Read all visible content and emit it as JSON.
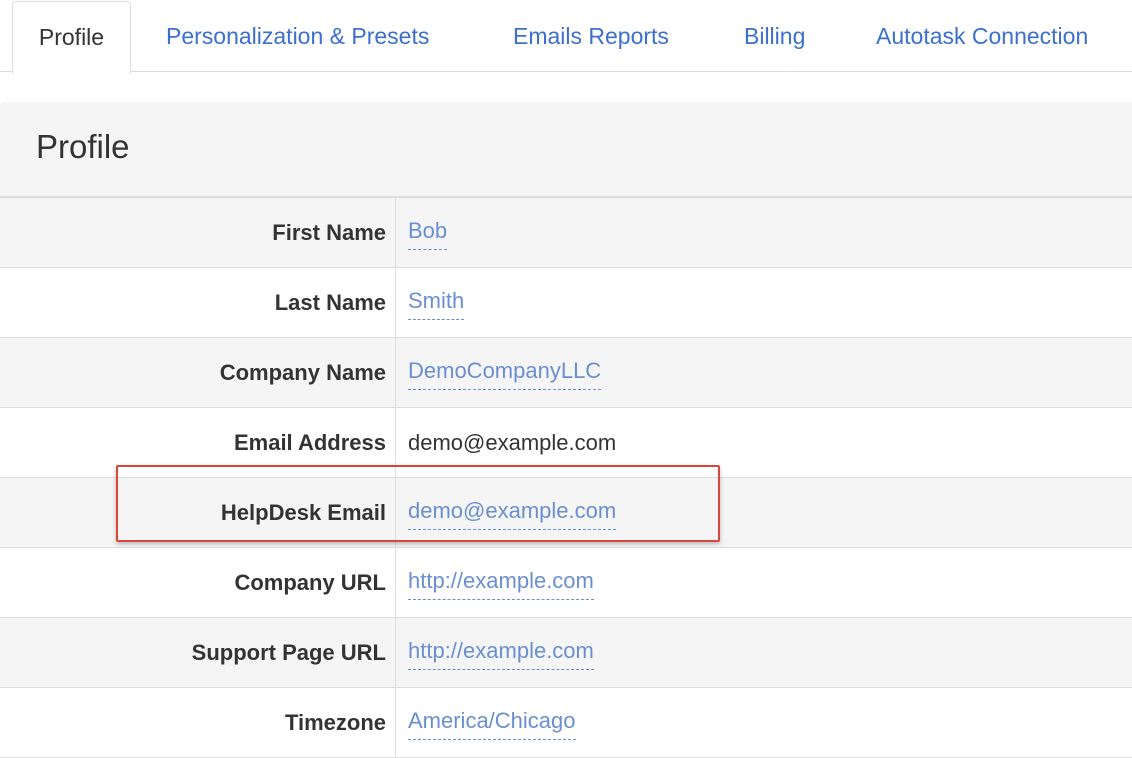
{
  "tabs": [
    {
      "label": "Profile",
      "active": true
    },
    {
      "label": "Personalization & Presets",
      "active": false
    },
    {
      "label": "Emails Reports",
      "active": false
    },
    {
      "label": "Billing",
      "active": false
    },
    {
      "label": "Autotask Connection",
      "active": false
    }
  ],
  "panel": {
    "title": "Profile"
  },
  "fields": [
    {
      "label": "First Name",
      "value": "Bob",
      "editable": true
    },
    {
      "label": "Last Name",
      "value": "Smith",
      "editable": true
    },
    {
      "label": "Company Name",
      "value": "DemoCompanyLLC",
      "editable": true
    },
    {
      "label": "Email Address",
      "value": "demo@example.com",
      "editable": false
    },
    {
      "label": "HelpDesk Email",
      "value": "demo@example.com",
      "editable": true,
      "highlighted": true
    },
    {
      "label": "Company URL",
      "value": "http://example.com",
      "editable": true
    },
    {
      "label": "Support Page URL",
      "value": "http://example.com",
      "editable": true
    },
    {
      "label": "Timezone",
      "value": "America/Chicago",
      "editable": true
    }
  ],
  "colors": {
    "link": "#3b6fd0",
    "editable_value": "#6a8fd0",
    "highlight_border": "#d9463c",
    "stripe": "#f5f5f5"
  }
}
